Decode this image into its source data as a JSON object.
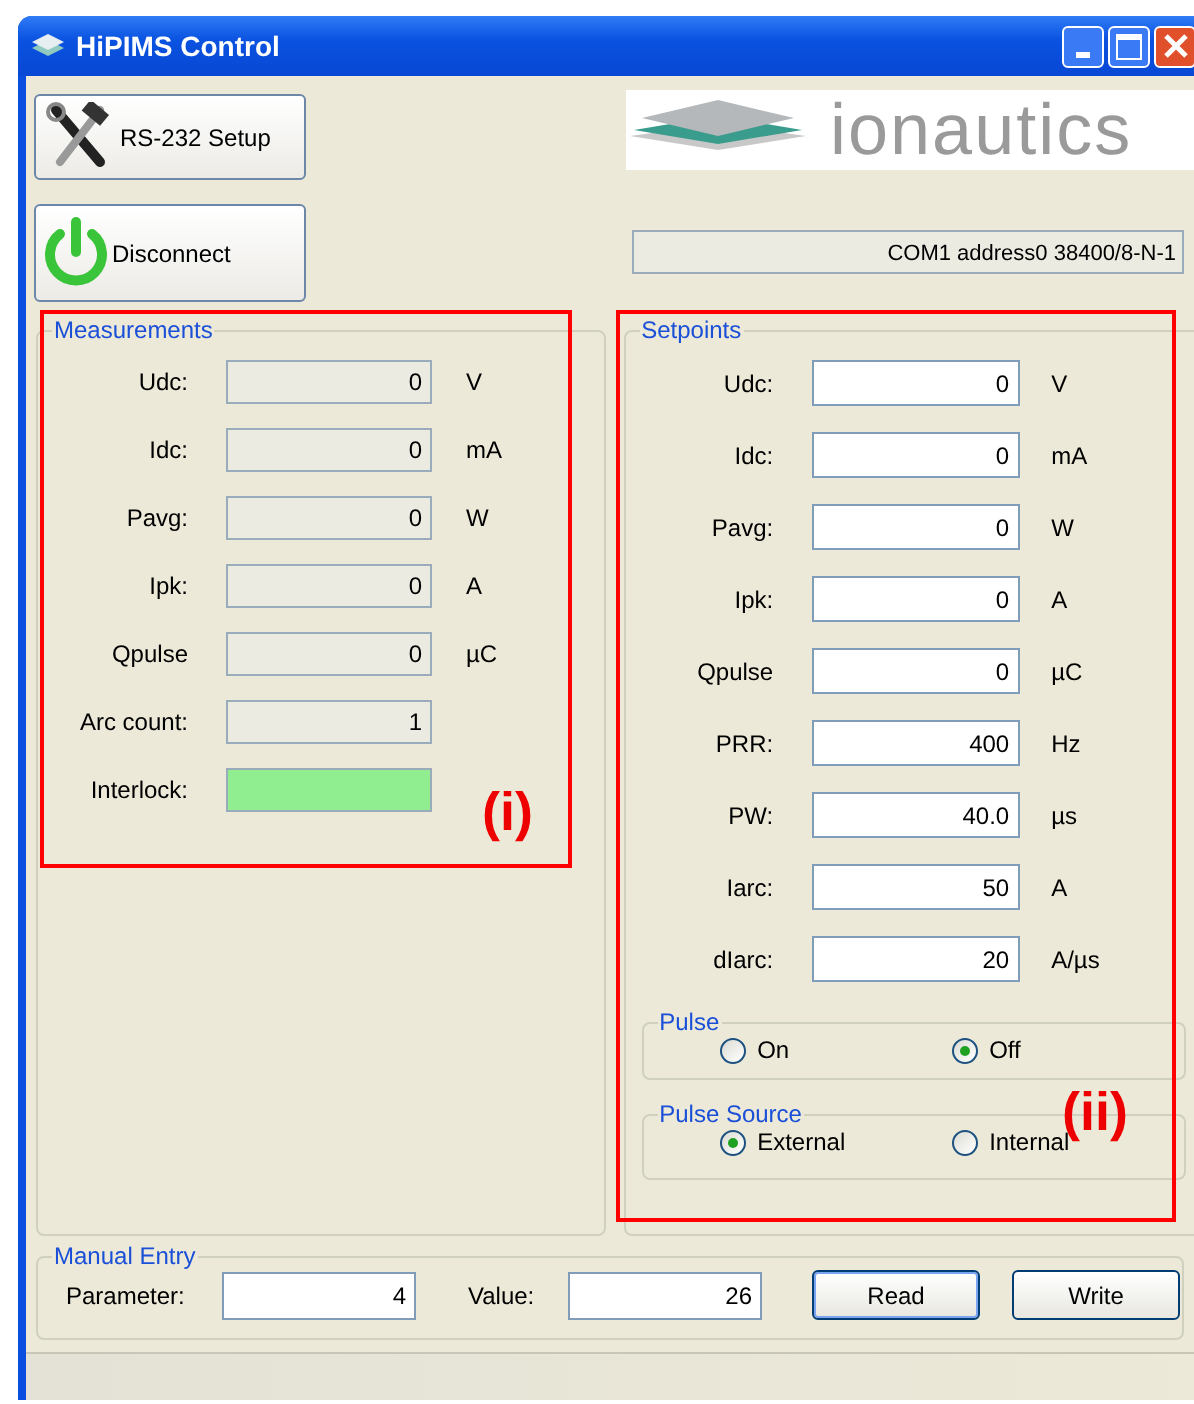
{
  "window": {
    "title": "HiPIMS Control"
  },
  "setup_button": "RS-232 Setup",
  "connect_button": "Disconnect",
  "logo": "ionautics",
  "connection_status": "COM1 address0 38400/8-N-1",
  "measurements": {
    "title": "Measurements",
    "rows": [
      {
        "kind": "reading",
        "label": "Udc:",
        "value": "0",
        "unit": "V"
      },
      {
        "kind": "reading",
        "label": "Idc:",
        "value": "0",
        "unit": "mA"
      },
      {
        "kind": "reading",
        "label": "Pavg:",
        "value": "0",
        "unit": "W"
      },
      {
        "kind": "reading",
        "label": "Ipk:",
        "value": "0",
        "unit": "A"
      },
      {
        "kind": "reading",
        "label": "Qpulse",
        "value": "0",
        "unit": "µC"
      },
      {
        "kind": "reading",
        "label": "Arc count:",
        "value": "1"
      },
      {
        "kind": "indicator",
        "label": "Interlock:",
        "on": true
      }
    ]
  },
  "setpoints": {
    "title": "Setpoints",
    "rows": [
      {
        "label": "Udc:",
        "value": "0",
        "unit": "V"
      },
      {
        "label": "Idc:",
        "value": "0",
        "unit": "mA"
      },
      {
        "label": "Pavg:",
        "value": "0",
        "unit": "W"
      },
      {
        "label": "Ipk:",
        "value": "0",
        "unit": "A"
      },
      {
        "label": "Qpulse",
        "value": "0",
        "unit": "µC"
      },
      {
        "label": "PRR:",
        "value": "400",
        "unit": "Hz"
      },
      {
        "label": "PW:",
        "value": "40.0",
        "unit": "µs"
      },
      {
        "label": "Iarc:",
        "value": "50",
        "unit": "A"
      },
      {
        "label": "dIarc:",
        "value": "20",
        "unit": "A/µs"
      }
    ],
    "radio_groups": [
      {
        "title": "Pulse",
        "options": [
          {
            "label": "On",
            "selected": false
          },
          {
            "label": "Off",
            "selected": true
          }
        ]
      },
      {
        "title": "Pulse Source",
        "options": [
          {
            "label": "External",
            "selected": true
          },
          {
            "label": "Internal",
            "selected": false
          }
        ]
      }
    ]
  },
  "manual_entry": {
    "title": "Manual Entry",
    "parameter_label": "Parameter:",
    "parameter": "4",
    "value_label": "Value:",
    "value": "26",
    "buttons": [
      "Read",
      "Write"
    ]
  },
  "annotations": [
    "(i)",
    "(ii)"
  ]
}
